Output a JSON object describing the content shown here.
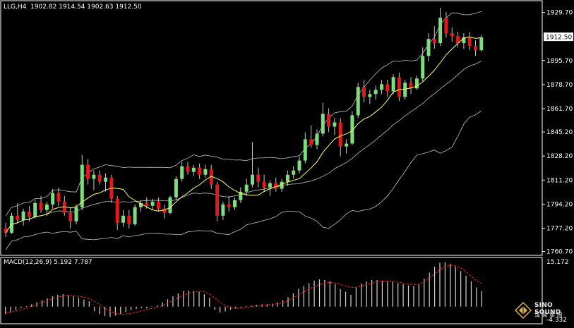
{
  "header": {
    "symbol": "LLG,H4",
    "open": "1902.82",
    "high": "1914.54",
    "low": "1902.63",
    "close": "1912.50",
    "macd_label": "MACD(12,26,9)",
    "macd_main": "5.192",
    "macd_signal": "7.787"
  },
  "watermark": {
    "brand": "SINO SOUND",
    "chinese": "漢 聲 集 團"
  },
  "colors": {
    "background": "#000000",
    "bull_candle": "#7fdc7f",
    "bear_candle": "#e11919",
    "wick": "#c8c8c8",
    "bands": "#bfbfbf",
    "moving_average": "#ffff66",
    "macd_histogram": "#d4d4d4",
    "macd_signal": "#ff2020",
    "axis": "#ffffff",
    "current_price_bg": "#ffffff"
  },
  "chart_data": [
    {
      "type": "candlestick",
      "title": "LLG,H4",
      "price_axis_ticks": [
        "1929.70",
        "1895.70",
        "1878.70",
        "1861.70",
        "1845.20",
        "1828.20",
        "1811.20",
        "1794.20",
        "1777.20",
        "1760.70"
      ],
      "current_price": "1912.50",
      "ylim": [
        1758,
        1938
      ],
      "indicators": [
        "Bollinger Bands",
        "Moving Average"
      ],
      "candles": [
        {
          "o": 1777,
          "h": 1781,
          "l": 1771,
          "c": 1774
        },
        {
          "o": 1774,
          "h": 1788,
          "l": 1773,
          "c": 1786
        },
        {
          "o": 1786,
          "h": 1795,
          "l": 1781,
          "c": 1783
        },
        {
          "o": 1783,
          "h": 1791,
          "l": 1779,
          "c": 1789
        },
        {
          "o": 1789,
          "h": 1793,
          "l": 1782,
          "c": 1785
        },
        {
          "o": 1785,
          "h": 1797,
          "l": 1784,
          "c": 1795
        },
        {
          "o": 1795,
          "h": 1800,
          "l": 1788,
          "c": 1790
        },
        {
          "o": 1790,
          "h": 1796,
          "l": 1786,
          "c": 1794
        },
        {
          "o": 1794,
          "h": 1805,
          "l": 1791,
          "c": 1802
        },
        {
          "o": 1802,
          "h": 1806,
          "l": 1793,
          "c": 1796
        },
        {
          "o": 1796,
          "h": 1800,
          "l": 1786,
          "c": 1788
        },
        {
          "o": 1788,
          "h": 1792,
          "l": 1777,
          "c": 1782
        },
        {
          "o": 1782,
          "h": 1794,
          "l": 1780,
          "c": 1792
        },
        {
          "o": 1792,
          "h": 1829,
          "l": 1790,
          "c": 1822
        },
        {
          "o": 1822,
          "h": 1826,
          "l": 1808,
          "c": 1812
        },
        {
          "o": 1812,
          "h": 1818,
          "l": 1804,
          "c": 1815
        },
        {
          "o": 1815,
          "h": 1818,
          "l": 1808,
          "c": 1810
        },
        {
          "o": 1810,
          "h": 1816,
          "l": 1803,
          "c": 1813
        },
        {
          "o": 1813,
          "h": 1815,
          "l": 1795,
          "c": 1798
        },
        {
          "o": 1798,
          "h": 1800,
          "l": 1776,
          "c": 1781
        },
        {
          "o": 1781,
          "h": 1790,
          "l": 1778,
          "c": 1786
        },
        {
          "o": 1786,
          "h": 1790,
          "l": 1777,
          "c": 1780
        },
        {
          "o": 1780,
          "h": 1794,
          "l": 1779,
          "c": 1792
        },
        {
          "o": 1792,
          "h": 1797,
          "l": 1789,
          "c": 1795
        },
        {
          "o": 1795,
          "h": 1799,
          "l": 1791,
          "c": 1793
        },
        {
          "o": 1793,
          "h": 1798,
          "l": 1790,
          "c": 1796
        },
        {
          "o": 1796,
          "h": 1799,
          "l": 1789,
          "c": 1791
        },
        {
          "o": 1791,
          "h": 1794,
          "l": 1784,
          "c": 1788
        },
        {
          "o": 1788,
          "h": 1800,
          "l": 1787,
          "c": 1799
        },
        {
          "o": 1799,
          "h": 1814,
          "l": 1797,
          "c": 1812
        },
        {
          "o": 1812,
          "h": 1824,
          "l": 1810,
          "c": 1821
        },
        {
          "o": 1821,
          "h": 1824,
          "l": 1815,
          "c": 1817
        },
        {
          "o": 1817,
          "h": 1822,
          "l": 1814,
          "c": 1820
        },
        {
          "o": 1820,
          "h": 1823,
          "l": 1812,
          "c": 1815
        },
        {
          "o": 1815,
          "h": 1822,
          "l": 1813,
          "c": 1819
        },
        {
          "o": 1819,
          "h": 1822,
          "l": 1805,
          "c": 1808
        },
        {
          "o": 1808,
          "h": 1810,
          "l": 1782,
          "c": 1786
        },
        {
          "o": 1786,
          "h": 1796,
          "l": 1783,
          "c": 1794
        },
        {
          "o": 1794,
          "h": 1800,
          "l": 1789,
          "c": 1792
        },
        {
          "o": 1792,
          "h": 1799,
          "l": 1790,
          "c": 1797
        },
        {
          "o": 1797,
          "h": 1806,
          "l": 1795,
          "c": 1803
        },
        {
          "o": 1803,
          "h": 1812,
          "l": 1800,
          "c": 1808
        },
        {
          "o": 1808,
          "h": 1838,
          "l": 1806,
          "c": 1815
        },
        {
          "o": 1815,
          "h": 1820,
          "l": 1806,
          "c": 1810
        },
        {
          "o": 1810,
          "h": 1815,
          "l": 1803,
          "c": 1806
        },
        {
          "o": 1806,
          "h": 1811,
          "l": 1800,
          "c": 1809
        },
        {
          "o": 1809,
          "h": 1813,
          "l": 1803,
          "c": 1805
        },
        {
          "o": 1805,
          "h": 1812,
          "l": 1803,
          "c": 1810
        },
        {
          "o": 1810,
          "h": 1818,
          "l": 1807,
          "c": 1815
        },
        {
          "o": 1815,
          "h": 1821,
          "l": 1812,
          "c": 1818
        },
        {
          "o": 1818,
          "h": 1828,
          "l": 1816,
          "c": 1825
        },
        {
          "o": 1825,
          "h": 1845,
          "l": 1823,
          "c": 1840
        },
        {
          "o": 1840,
          "h": 1850,
          "l": 1834,
          "c": 1836
        },
        {
          "o": 1836,
          "h": 1847,
          "l": 1833,
          "c": 1844
        },
        {
          "o": 1844,
          "h": 1866,
          "l": 1842,
          "c": 1858
        },
        {
          "o": 1858,
          "h": 1862,
          "l": 1845,
          "c": 1849
        },
        {
          "o": 1849,
          "h": 1855,
          "l": 1843,
          "c": 1852
        },
        {
          "o": 1852,
          "h": 1855,
          "l": 1828,
          "c": 1835
        },
        {
          "o": 1835,
          "h": 1840,
          "l": 1830,
          "c": 1837
        },
        {
          "o": 1837,
          "h": 1860,
          "l": 1836,
          "c": 1857
        },
        {
          "o": 1857,
          "h": 1880,
          "l": 1855,
          "c": 1877
        },
        {
          "o": 1877,
          "h": 1882,
          "l": 1866,
          "c": 1870
        },
        {
          "o": 1870,
          "h": 1875,
          "l": 1865,
          "c": 1872
        },
        {
          "o": 1872,
          "h": 1878,
          "l": 1868,
          "c": 1875
        },
        {
          "o": 1875,
          "h": 1882,
          "l": 1872,
          "c": 1879
        },
        {
          "o": 1879,
          "h": 1882,
          "l": 1870,
          "c": 1874
        },
        {
          "o": 1874,
          "h": 1886,
          "l": 1872,
          "c": 1884
        },
        {
          "o": 1884,
          "h": 1887,
          "l": 1867,
          "c": 1870
        },
        {
          "o": 1870,
          "h": 1882,
          "l": 1868,
          "c": 1880
        },
        {
          "o": 1880,
          "h": 1884,
          "l": 1872,
          "c": 1876
        },
        {
          "o": 1876,
          "h": 1885,
          "l": 1875,
          "c": 1883
        },
        {
          "o": 1883,
          "h": 1905,
          "l": 1881,
          "c": 1899
        },
        {
          "o": 1899,
          "h": 1915,
          "l": 1895,
          "c": 1911
        },
        {
          "o": 1911,
          "h": 1920,
          "l": 1904,
          "c": 1908
        },
        {
          "o": 1908,
          "h": 1933,
          "l": 1906,
          "c": 1926
        },
        {
          "o": 1926,
          "h": 1930,
          "l": 1912,
          "c": 1915
        },
        {
          "o": 1915,
          "h": 1919,
          "l": 1909,
          "c": 1913
        },
        {
          "o": 1913,
          "h": 1916,
          "l": 1905,
          "c": 1908
        },
        {
          "o": 1908,
          "h": 1915,
          "l": 1904,
          "c": 1912
        },
        {
          "o": 1912,
          "h": 1916,
          "l": 1903,
          "c": 1906
        },
        {
          "o": 1906,
          "h": 1910,
          "l": 1899,
          "c": 1903
        },
        {
          "o": 1903,
          "h": 1914,
          "l": 1902,
          "c": 1912
        }
      ]
    },
    {
      "type": "bar",
      "title": "MACD(12,26,9)",
      "ylim": [
        -4.332,
        15.172
      ],
      "axis_ticks": [
        "15.172",
        "-4.332"
      ],
      "series": [
        {
          "name": "5.192",
          "values": [
            -2.5,
            -2.0,
            -1.2,
            -0.5,
            0.2,
            0.8,
            1.5,
            2.2,
            2.8,
            3.5,
            4.0,
            4.2,
            4.0,
            3.5,
            3.0,
            2.4,
            1.8,
            -1.5,
            -2.5,
            -3.2,
            -3.5,
            -3.0,
            -2.4,
            -1.8,
            -1.2,
            -0.8,
            -0.5,
            -0.6,
            -0.2,
            0.5,
            1.5,
            2.5,
            3.5,
            4.5,
            5.2,
            5.5,
            5.4,
            5.0,
            4.2,
            3.0,
            -1.0,
            -2.0,
            -1.6,
            -1.0,
            -0.6,
            -0.3,
            0.2,
            0.4,
            0.6,
            0.8,
            0.8,
            1.0,
            1.4,
            2.2,
            3.2,
            4.5,
            6.0,
            7.0,
            8.0,
            8.8,
            9.2,
            9.0,
            8.6,
            7.5,
            6.0,
            5.0,
            4.0,
            6.5,
            7.8,
            8.5,
            9.0,
            9.0,
            8.8,
            8.6,
            8.4,
            8.0,
            7.6,
            7.2,
            7.0,
            7.5,
            9.5,
            11.5,
            13.5,
            14.8,
            15.0,
            14.5,
            13.5,
            12.0,
            10.5,
            8.5,
            6.5,
            5.2
          ]
        },
        {
          "name": "7.787",
          "values": [
            -2.0,
            -1.8,
            -1.5,
            -1.0,
            -0.5,
            0.2,
            0.8,
            1.5,
            2.1,
            2.7,
            3.2,
            3.6,
            3.8,
            3.7,
            3.5,
            3.2,
            2.8,
            1.8,
            0.8,
            -0.5,
            -1.5,
            -2.2,
            -2.6,
            -2.5,
            -2.2,
            -1.8,
            -1.4,
            -1.0,
            -0.6,
            -0.2,
            0.4,
            1.2,
            2.0,
            3.0,
            3.8,
            4.5,
            5.0,
            5.2,
            5.0,
            4.3,
            3.0,
            1.5,
            0.5,
            -0.3,
            -0.6,
            -0.5,
            -0.3,
            0.0,
            0.3,
            0.5,
            0.6,
            0.8,
            1.0,
            1.4,
            2.0,
            3.0,
            4.0,
            5.0,
            6.0,
            6.8,
            7.5,
            8.0,
            8.2,
            8.0,
            7.5,
            7.0,
            6.5,
            6.5,
            7.0,
            7.5,
            8.0,
            8.5,
            8.6,
            8.6,
            8.5,
            8.3,
            8.0,
            7.7,
            7.5,
            7.6,
            8.5,
            9.8,
            11.0,
            12.5,
            13.5,
            14.0,
            13.8,
            13.0,
            11.8,
            10.2,
            8.8,
            7.8
          ]
        }
      ]
    }
  ]
}
